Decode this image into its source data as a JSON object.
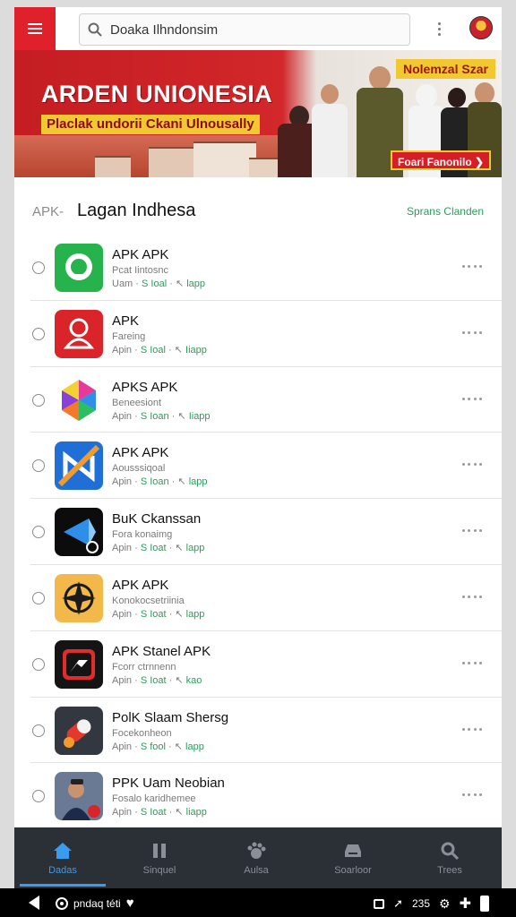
{
  "topbar": {
    "search_text": "Doaka Ilhndonsim",
    "icons": [
      "menu-icon",
      "search-icon",
      "overflow-icon",
      "avatar"
    ]
  },
  "banner": {
    "title": "ARDEN UNIONESIA",
    "subtitle": "Placlak undorii Ckani Ulnousally",
    "badge": "Nolemzal Szar",
    "cta": "Foari Fanonilo"
  },
  "section": {
    "prefix": "APK-",
    "title": "Lagan Indhesa",
    "link": "Sprans Clanden"
  },
  "apps": [
    {
      "name": "APK APK",
      "sub": "Pcat Iintosnc",
      "meta_a": "Uam",
      "meta_b": "S Ioal",
      "meta_c": "lapp",
      "icon": "chat-bubble-icon",
      "color": "#27b34b"
    },
    {
      "name": "APK",
      "sub": "Fareing",
      "meta_a": "Apin",
      "meta_b": "S Ioal",
      "meta_c": "Iiapp",
      "icon": "person-outline-icon",
      "color": "#d9252a"
    },
    {
      "name": "APKS APK",
      "sub": "Beneesiont",
      "meta_a": "Apin",
      "meta_b": "S Ioan",
      "meta_c": "Iiapp",
      "icon": "crystal-gem-icon",
      "color": "#ffffff"
    },
    {
      "name": "APK APK",
      "sub": "Aousssiqoal",
      "meta_a": "Apin",
      "meta_b": "S Ioan",
      "meta_c": "lapp",
      "icon": "crossed-n-icon",
      "color": "#1f6fd6"
    },
    {
      "name": "BuK Ckanssan",
      "sub": "Fora konaimg",
      "meta_a": "Apin",
      "meta_b": "S Ioat",
      "meta_c": "lapp",
      "icon": "blue-arrow-icon",
      "color": "#0c0c0c"
    },
    {
      "name": "APK APK",
      "sub": "Konokocsetriinia",
      "meta_a": "Apin",
      "meta_b": "S Ioat",
      "meta_c": "lapp",
      "icon": "compass-emblem-icon",
      "color": "#f2b84a"
    },
    {
      "name": "APK Stanel APK",
      "sub": "Fcorr ctrnnenn",
      "meta_a": "Apin",
      "meta_b": "S Ioat",
      "meta_c": "kao",
      "icon": "swoosh-icon",
      "color": "#141414"
    },
    {
      "name": "PolK Slaam Shersg",
      "sub": "Focekonheon",
      "meta_a": "Apin",
      "meta_b": "S fool",
      "meta_c": "lapp",
      "icon": "capsule-icon",
      "color": "#333840"
    },
    {
      "name": "PPK Uam Neobian",
      "sub": "Fosalo karidhemee",
      "meta_a": "Apin",
      "meta_b": "S Ioat",
      "meta_c": "liapp",
      "icon": "portrait-icon",
      "color": "#3a4a6a"
    }
  ],
  "bottom_nav": [
    {
      "label": "Dadas",
      "icon": "home-icon",
      "active": true
    },
    {
      "label": "Sinquel",
      "icon": "pause-bars-icon",
      "active": false
    },
    {
      "label": "Aulsa",
      "icon": "paw-icon",
      "active": false
    },
    {
      "label": "Soarloor",
      "icon": "drawer-icon",
      "active": false
    },
    {
      "label": "Trees",
      "icon": "search-icon",
      "active": false
    }
  ],
  "system_bar": {
    "left_text": "pndaq téti",
    "right_text": "235"
  },
  "colors": {
    "accent_red": "#e0202a",
    "accent_green": "#2f9a5c",
    "nav_active": "#3a9bef",
    "nav_bg": "#2b2f36"
  }
}
